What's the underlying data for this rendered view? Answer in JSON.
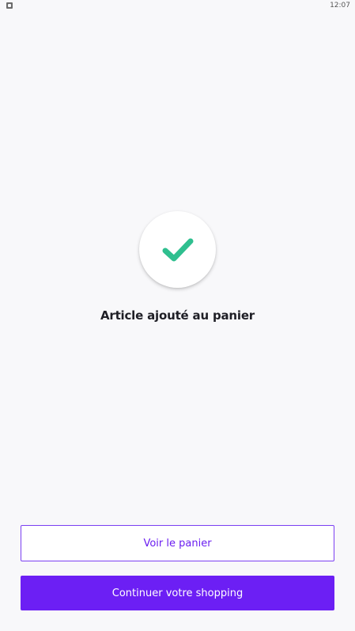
{
  "status_bar": {
    "app_icon": "app-notification-icon",
    "time": "12:07"
  },
  "confirmation": {
    "icon": "checkmark-icon",
    "check_color": "#2fbf8f",
    "title": "Article ajouté au panier"
  },
  "actions": {
    "view_cart_label": "Voir le panier",
    "continue_shopping_label": "Continuer votre shopping",
    "accent_color": "#6c1ff4"
  }
}
